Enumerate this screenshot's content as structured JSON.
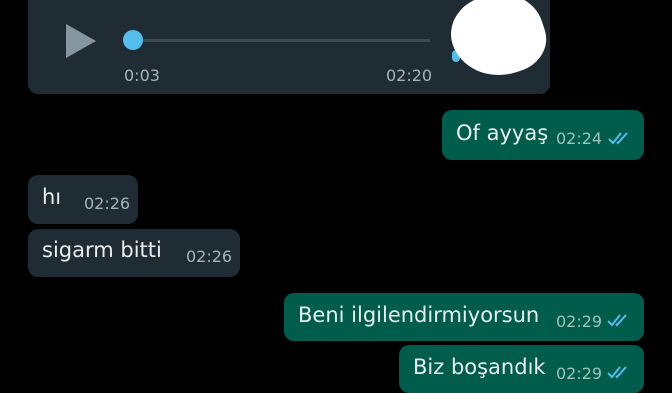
{
  "voice_message": {
    "elapsed": "0:03",
    "time": "02:20",
    "progress": 0.0
  },
  "messages": [
    {
      "direction": "out",
      "text": "Of ayyaş",
      "time": "02:24",
      "status": "read"
    },
    {
      "direction": "in",
      "text": "hı",
      "time": "02:26"
    },
    {
      "direction": "in",
      "text": "sigarm bitti",
      "time": "02:26"
    },
    {
      "direction": "out",
      "text": "Beni ilgilendirmiyorsun",
      "time": "02:29",
      "status": "read"
    },
    {
      "direction": "out",
      "text": "Biz boşandık",
      "time": "02:29",
      "status": "read"
    }
  ],
  "colors": {
    "background": "#000000",
    "incoming_bubble": "#202c33",
    "outgoing_bubble": "#005c4b",
    "read_ticks": "#53bdeb"
  }
}
